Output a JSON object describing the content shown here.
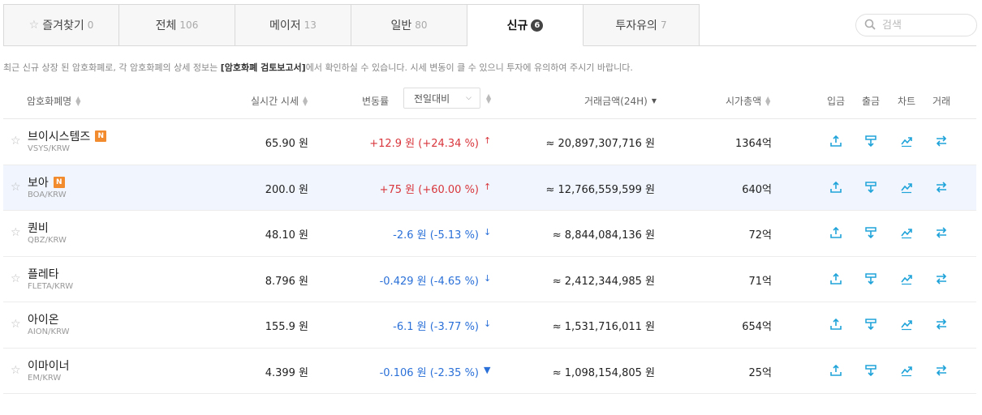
{
  "tabs": [
    {
      "label": "즐겨찾기",
      "count": "0"
    },
    {
      "label": "전체",
      "count": "106"
    },
    {
      "label": "메이저",
      "count": "13"
    },
    {
      "label": "일반",
      "count": "80"
    },
    {
      "label": "신규",
      "count": "6"
    },
    {
      "label": "투자유의",
      "count": "7"
    }
  ],
  "search": {
    "placeholder": "검색"
  },
  "notice": {
    "prefix": "최근 신규 상장 된 암호화폐로, 각 암호화폐의 상세 정보는 ",
    "bold": "[암호화폐 검토보고서]",
    "suffix": "에서 확인하실 수 있습니다. 시세 변동이 클 수 있으니 투자에 유의하여 주시기 바랍니다."
  },
  "header": {
    "name": "암호화폐명",
    "price": "실시간 시세",
    "change": "변동률",
    "change_select": "전일대비",
    "volume": "거래금액(24H)",
    "cap": "시가총액",
    "deposit": "입금",
    "withdraw": "출금",
    "chart": "차트",
    "trade": "거래"
  },
  "rows": [
    {
      "name": "브이시스템즈",
      "pair": "VSYS/KRW",
      "new": "N",
      "price": "65.90 원",
      "change": "+12.9 원 (+24.34 %)",
      "dir": "up",
      "volume": "≈ 20,897,307,716 원",
      "cap": "1364억"
    },
    {
      "name": "보아",
      "pair": "BOA/KRW",
      "new": "N",
      "price": "200.0 원",
      "change": "+75 원 (+60.00 %)",
      "dir": "up",
      "volume": "≈ 12,766,559,599 원",
      "cap": "640억"
    },
    {
      "name": "퀀비",
      "pair": "QBZ/KRW",
      "new": "",
      "price": "48.10 원",
      "change": "-2.6 원 (-5.13 %)",
      "dir": "dn",
      "volume": "≈ 8,844,084,136 원",
      "cap": "72억"
    },
    {
      "name": "플레타",
      "pair": "FLETA/KRW",
      "new": "",
      "price": "8.796 원",
      "change": "-0.429 원 (-4.65 %)",
      "dir": "dn",
      "volume": "≈ 2,412,344,985 원",
      "cap": "71억"
    },
    {
      "name": "아이온",
      "pair": "AION/KRW",
      "new": "",
      "price": "155.9 원",
      "change": "-6.1 원 (-3.77 %)",
      "dir": "dn",
      "volume": "≈ 1,531,716,011 원",
      "cap": "654억"
    },
    {
      "name": "이마이너",
      "pair": "EM/KRW",
      "new": "",
      "price": "4.399 원",
      "change": "-0.106 원 (-2.35 %)",
      "dir": "dn",
      "volume": "≈ 1,098,154,805 원",
      "cap": "25억"
    }
  ],
  "colors": {
    "up": "#d8363c",
    "down": "#2a70d8",
    "icon": "#1fa3d9",
    "badge": "#f28a2e"
  }
}
